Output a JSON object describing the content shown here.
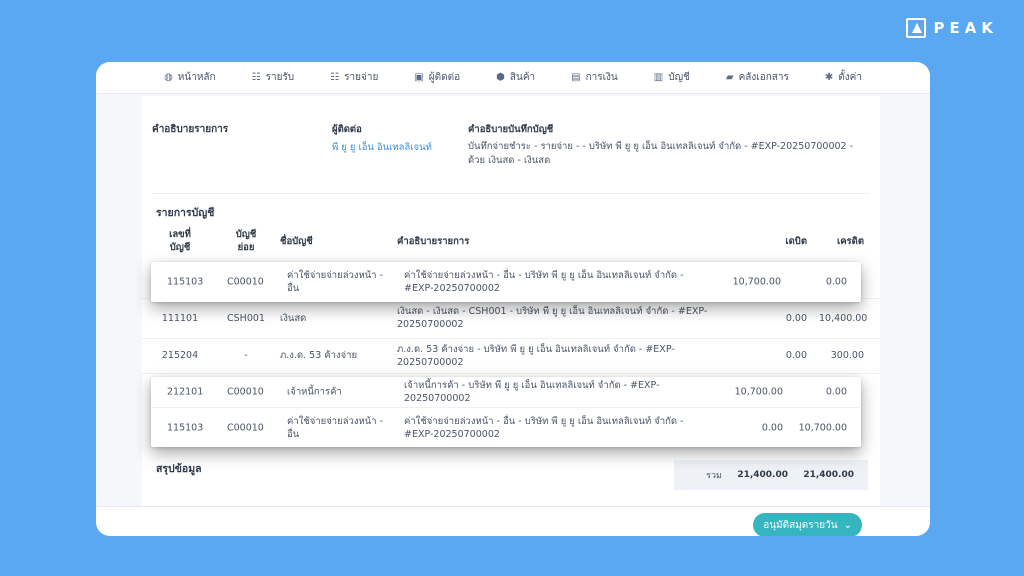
{
  "brand": {
    "name": "PEAK"
  },
  "nav": {
    "items": [
      {
        "label": "หน้าหลัก",
        "icon": "dashboard-icon",
        "glyph": "◍"
      },
      {
        "label": "รายรับ",
        "icon": "income-list-icon",
        "glyph": "☷"
      },
      {
        "label": "รายจ่าย",
        "icon": "expense-list-icon",
        "glyph": "☷"
      },
      {
        "label": "ผู้ติดต่อ",
        "icon": "contacts-icon",
        "glyph": "▣"
      },
      {
        "label": "สินค้า",
        "icon": "product-box-icon",
        "glyph": "⬢"
      },
      {
        "label": "การเงิน",
        "icon": "money-icon",
        "glyph": "▤"
      },
      {
        "label": "บัญชี",
        "icon": "ledger-icon",
        "glyph": "▥"
      },
      {
        "label": "คลังเอกสาร",
        "icon": "folder-icon",
        "glyph": "▰"
      },
      {
        "label": "ตั้งค่า",
        "icon": "gear-icon",
        "glyph": "✱"
      }
    ]
  },
  "info": {
    "label": "คำอธิบายรายการ",
    "contact_title": "ผู้ติดต่อ",
    "contact_name": "พี ยู ยู เอ็น อินเทลลิเจนท์",
    "memo_title": "คำอธิบายบันทึกบัญชี",
    "memo_text": "บันทึกจ่ายชำระ - รายจ่าย - - บริษัท พี ยู ยู เอ็น อินเทลลิเจนท์ จำกัด - #EXP-20250700002 - ด้วย เงินสด - เงินสด"
  },
  "accounts": {
    "section_title": "รายการบัญชี",
    "headers": {
      "code": "เลขที่\nบัญชี",
      "sub": "บัญชี\nย่อย",
      "name": "ชื่อบัญชี",
      "desc": "คำอธิบายรายการ",
      "debit": "เดบิต",
      "credit": "เครดิต"
    },
    "rows": [
      {
        "code": "115103",
        "sub": "C00010",
        "name": "ค่าใช้จ่ายจ่ายล่วงหน้า - อื่น",
        "desc": "ค่าใช้จ่ายจ่ายล่วงหน้า - อื่น - บริษัท พี ยู ยู เอ็น อินเทลลิเจนท์ จำกัด - #EXP-20250700002",
        "debit": "10,700.00",
        "credit": "0.00"
      },
      {
        "code": "111101",
        "sub": "CSH001",
        "name": "เงินสด",
        "desc": "เงินสด - เงินสด - CSH001 - บริษัท พี ยู ยู เอ็น อินเทลลิเจนท์ จำกัด - #EXP-20250700002",
        "debit": "0.00",
        "credit": "10,400.00"
      },
      {
        "code": "215204",
        "sub": "-",
        "name": "ภ.ง.ด. 53 ค้างจ่าย",
        "desc": "ภ.ง.ด. 53 ค้างจ่าย - บริษัท พี ยู ยู เอ็น อินเทลลิเจนท์ จำกัด - #EXP-20250700002",
        "debit": "0.00",
        "credit": "300.00"
      },
      {
        "code": "212101",
        "sub": "C00010",
        "name": "เจ้าหนี้การค้า",
        "desc": "เจ้าหนี้การค้า - บริษัท พี ยู ยู เอ็น อินเทลลิเจนท์ จำกัด - #EXP-20250700002",
        "debit": "10,700.00",
        "credit": "0.00"
      },
      {
        "code": "115103",
        "sub": "C00010",
        "name": "ค่าใช้จ่ายจ่ายล่วงหน้า - อื่น",
        "desc": "ค่าใช้จ่ายจ่ายล่วงหน้า - อื่น - บริษัท พี ยู ยู เอ็น อินเทลลิเจนท์ จำกัด - #EXP-20250700002",
        "debit": "0.00",
        "credit": "10,700.00"
      }
    ]
  },
  "summary": {
    "title": "สรุปข้อมูล",
    "total_label": "รวม",
    "total_debit": "21,400.00",
    "total_credit": "21,400.00"
  },
  "footer": {
    "approve_label": "อนุมัติสมุดรายวัน",
    "approve_color": "#35b5bf"
  },
  "colors": {
    "background": "#5ba8f2",
    "link": "#3b8ee0"
  }
}
